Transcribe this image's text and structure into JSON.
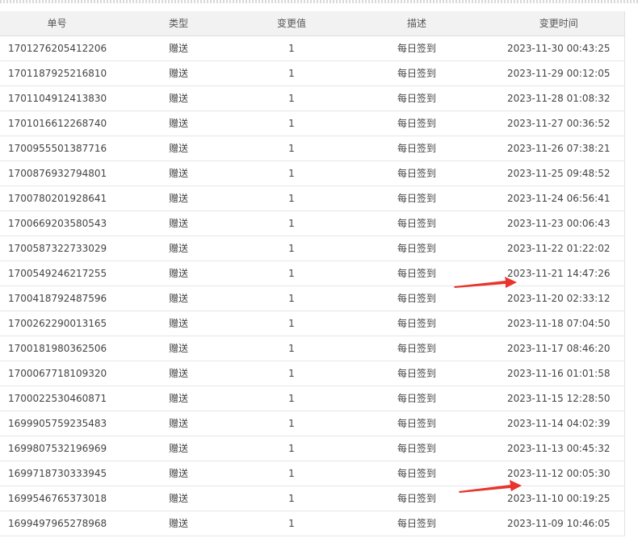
{
  "table": {
    "headers": [
      "单号",
      "类型",
      "变更值",
      "描述",
      "变更时间"
    ],
    "rows": [
      {
        "id": "1701276205412206",
        "type": "赠送",
        "value": "1",
        "desc": "每日签到",
        "time": "2023-11-30 00:43:25"
      },
      {
        "id": "1701187925216810",
        "type": "赠送",
        "value": "1",
        "desc": "每日签到",
        "time": "2023-11-29 00:12:05"
      },
      {
        "id": "1701104912413830",
        "type": "赠送",
        "value": "1",
        "desc": "每日签到",
        "time": "2023-11-28 01:08:32"
      },
      {
        "id": "1701016612268740",
        "type": "赠送",
        "value": "1",
        "desc": "每日签到",
        "time": "2023-11-27 00:36:52"
      },
      {
        "id": "1700955501387716",
        "type": "赠送",
        "value": "1",
        "desc": "每日签到",
        "time": "2023-11-26 07:38:21"
      },
      {
        "id": "1700876932794801",
        "type": "赠送",
        "value": "1",
        "desc": "每日签到",
        "time": "2023-11-25 09:48:52"
      },
      {
        "id": "1700780201928641",
        "type": "赠送",
        "value": "1",
        "desc": "每日签到",
        "time": "2023-11-24 06:56:41"
      },
      {
        "id": "1700669203580543",
        "type": "赠送",
        "value": "1",
        "desc": "每日签到",
        "time": "2023-11-23 00:06:43"
      },
      {
        "id": "1700587322733029",
        "type": "赠送",
        "value": "1",
        "desc": "每日签到",
        "time": "2023-11-22 01:22:02"
      },
      {
        "id": "1700549246217255",
        "type": "赠送",
        "value": "1",
        "desc": "每日签到",
        "time": "2023-11-21 14:47:26"
      },
      {
        "id": "1700418792487596",
        "type": "赠送",
        "value": "1",
        "desc": "每日签到",
        "time": "2023-11-20 02:33:12"
      },
      {
        "id": "1700262290013165",
        "type": "赠送",
        "value": "1",
        "desc": "每日签到",
        "time": "2023-11-18 07:04:50"
      },
      {
        "id": "1700181980362506",
        "type": "赠送",
        "value": "1",
        "desc": "每日签到",
        "time": "2023-11-17 08:46:20"
      },
      {
        "id": "1700067718109320",
        "type": "赠送",
        "value": "1",
        "desc": "每日签到",
        "time": "2023-11-16 01:01:58"
      },
      {
        "id": "1700022530460871",
        "type": "赠送",
        "value": "1",
        "desc": "每日签到",
        "time": "2023-11-15 12:28:50"
      },
      {
        "id": "1699905759235483",
        "type": "赠送",
        "value": "1",
        "desc": "每日签到",
        "time": "2023-11-14 04:02:39"
      },
      {
        "id": "1699807532196969",
        "type": "赠送",
        "value": "1",
        "desc": "每日签到",
        "time": "2023-11-13 00:45:32"
      },
      {
        "id": "1699718730333945",
        "type": "赠送",
        "value": "1",
        "desc": "每日签到",
        "time": "2023-11-12 00:05:30"
      },
      {
        "id": "1699546765373018",
        "type": "赠送",
        "value": "1",
        "desc": "每日签到",
        "time": "2023-11-10 00:19:25"
      },
      {
        "id": "1699497965278968",
        "type": "赠送",
        "value": "1",
        "desc": "每日签到",
        "time": "2023-11-09 10:46:05"
      }
    ]
  },
  "annotations": {
    "arrow_color": "#e8342c",
    "arrows": [
      "red-arrow-icon",
      "red-arrow-icon"
    ]
  }
}
